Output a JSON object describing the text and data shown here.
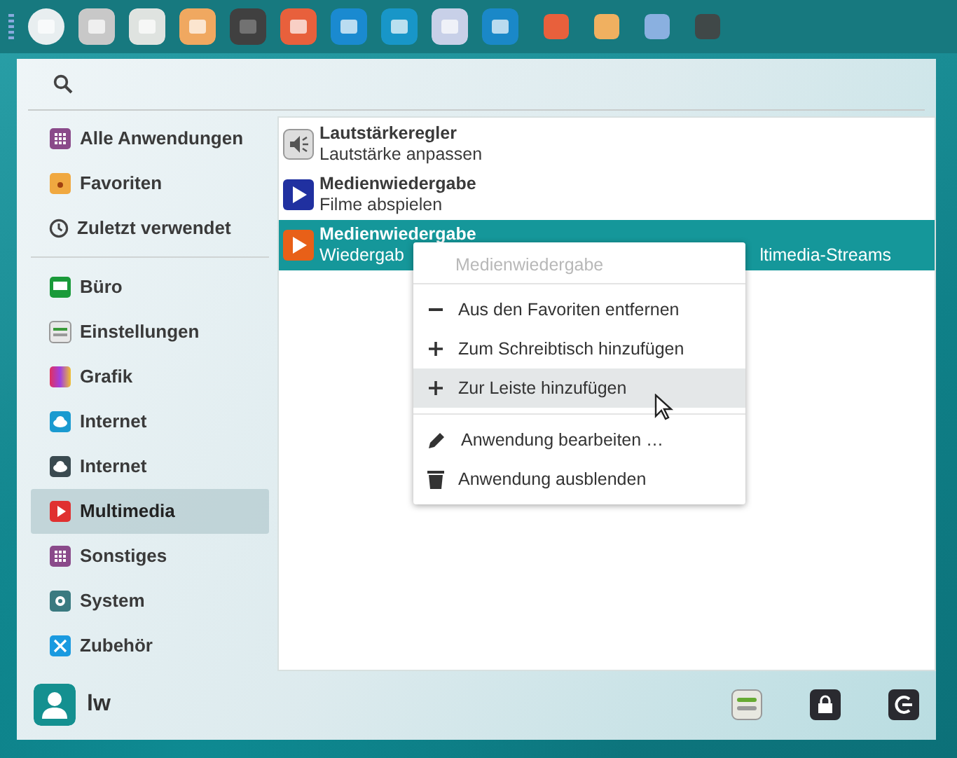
{
  "sidebar": {
    "favorites": [
      {
        "label": "Alle Anwendungen",
        "selected": false
      },
      {
        "label": "Favoriten",
        "selected": false
      },
      {
        "label": "Zuletzt verwendet",
        "selected": false
      }
    ],
    "categories": [
      {
        "label": "Büro",
        "selected": false
      },
      {
        "label": "Einstellungen",
        "selected": false
      },
      {
        "label": "Grafik",
        "selected": false
      },
      {
        "label": "Internet",
        "selected": false
      },
      {
        "label": "Internet",
        "selected": false
      },
      {
        "label": "Multimedia",
        "selected": true
      },
      {
        "label": "Sonstiges",
        "selected": false
      },
      {
        "label": "System",
        "selected": false
      },
      {
        "label": "Zubehör",
        "selected": false
      }
    ]
  },
  "apps": [
    {
      "title": "Lautstärkeregler",
      "subtitle_parts": [
        "Lautstärke anpassen"
      ],
      "selected": false
    },
    {
      "title": "Medienwiedergabe",
      "subtitle_parts": [
        "Filme abspielen"
      ],
      "selected": false
    },
    {
      "title": "Medienwiedergabe",
      "subtitle_parts": [
        "Wiedergab",
        "ltimedia-Streams"
      ],
      "selected": true
    }
  ],
  "context_menu": {
    "header": "Medienwiedergabe",
    "sections": [
      [
        {
          "label": "Aus den Favoriten entfernen",
          "kind": "minus",
          "selected": false
        },
        {
          "label": "Zum Schreibtisch hinzufügen",
          "kind": "plus",
          "selected": false
        },
        {
          "label": "Zur Leiste hinzufügen",
          "kind": "plus",
          "selected": true
        }
      ],
      [
        {
          "label": "Anwendung bearbeiten …",
          "kind": "pencil",
          "selected": false
        },
        {
          "label": "Anwendung ausblenden",
          "kind": "trash",
          "selected": false
        }
      ]
    ]
  },
  "user": {
    "name": "lw"
  }
}
